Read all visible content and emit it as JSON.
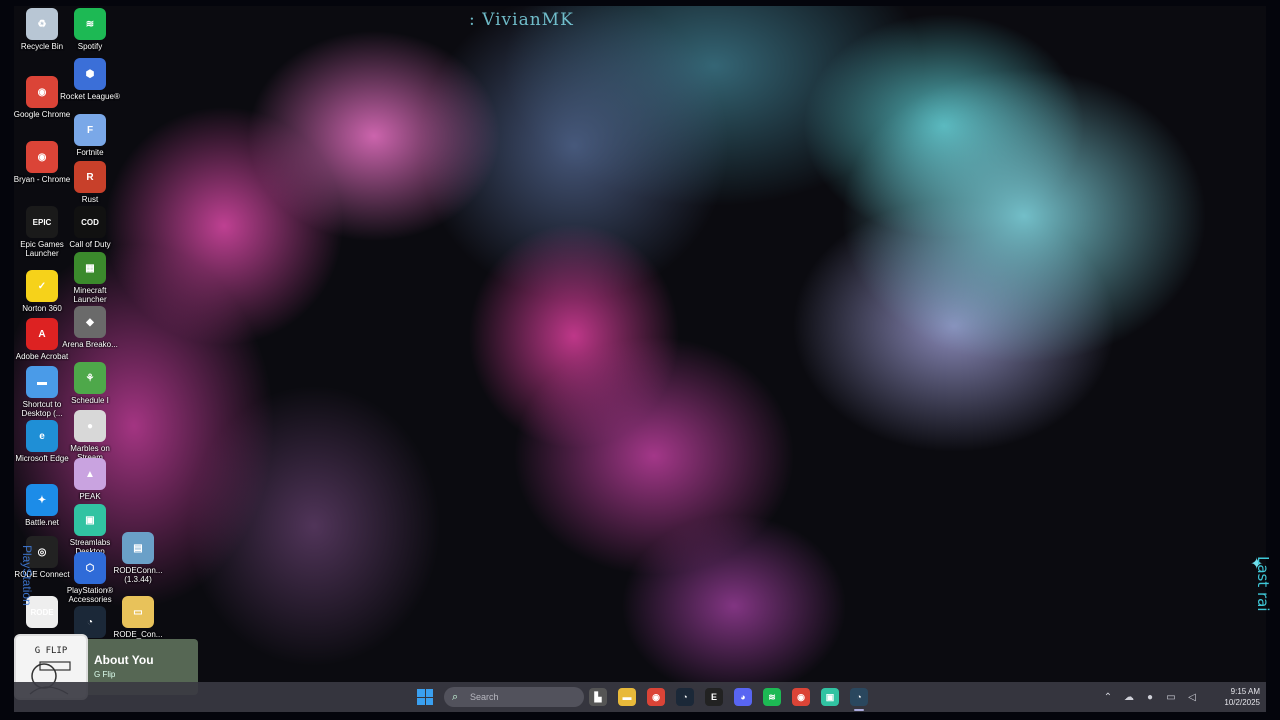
{
  "overlay": {
    "name": ": VivianMK",
    "side_text": "Last rai",
    "left_vertical": "PlayStation"
  },
  "desktop_icons": {
    "col1": [
      {
        "label": "Recycle Bin",
        "icon": "recycle-bin-icon",
        "color": "#b8c6d4",
        "glyph": "♻"
      },
      {
        "label": "Google Chrome",
        "icon": "chrome-icon",
        "color": "#db4437",
        "glyph": "◉"
      },
      {
        "label": "Bryan - Chrome",
        "icon": "chrome-profile-icon",
        "color": "#db4437",
        "glyph": "◉"
      },
      {
        "label": "Epic Games Launcher",
        "icon": "epic-games-icon",
        "color": "#1a1a1a",
        "glyph": "EPIC"
      },
      {
        "label": "Norton 360",
        "icon": "norton-icon",
        "color": "#f6d21a",
        "glyph": "✓"
      },
      {
        "label": "Adobe Acrobat",
        "icon": "acrobat-icon",
        "color": "#d22",
        "glyph": "A"
      },
      {
        "label": "Shortcut to Desktop (...",
        "icon": "shortcut-icon",
        "color": "#4a9be8",
        "glyph": "▬"
      },
      {
        "label": "Microsoft Edge",
        "icon": "edge-icon",
        "color": "#1f8fd6",
        "glyph": "e"
      },
      {
        "label": "Battle.net",
        "icon": "battlenet-icon",
        "color": "#1c8ce8",
        "glyph": "✦"
      },
      {
        "label": "RODE Connect",
        "icon": "rode-connect-icon",
        "color": "#222",
        "glyph": "◎"
      },
      {
        "label": "",
        "icon": "rode-icon",
        "color": "#eee",
        "glyph": "RODE"
      }
    ],
    "col2": [
      {
        "label": "Spotify",
        "icon": "spotify-icon",
        "color": "#1db954",
        "glyph": "≋"
      },
      {
        "label": "Rocket League®",
        "icon": "rocket-league-icon",
        "color": "#3b6fd8",
        "glyph": "⬢"
      },
      {
        "label": "Fortnite",
        "icon": "fortnite-icon",
        "color": "#7aa8e8",
        "glyph": "F"
      },
      {
        "label": "Rust",
        "icon": "rust-icon",
        "color": "#c8402a",
        "glyph": "R"
      },
      {
        "label": "Call of Duty",
        "icon": "call-of-duty-icon",
        "color": "#111",
        "glyph": "COD"
      },
      {
        "label": "Minecraft Launcher",
        "icon": "minecraft-icon",
        "color": "#3b8a2c",
        "glyph": "▦"
      },
      {
        "label": "Arena Breako...",
        "icon": "arena-breakout-icon",
        "color": "#6a6a6a",
        "glyph": "◆"
      },
      {
        "label": "Schedule I",
        "icon": "schedule-one-icon",
        "color": "#4ea84a",
        "glyph": "⚘"
      },
      {
        "label": "Marbles on Stream",
        "icon": "marbles-icon",
        "color": "#d8d8d8",
        "glyph": "●"
      },
      {
        "label": "PEAK",
        "icon": "peak-icon",
        "color": "#c9a3e0",
        "glyph": "▲"
      },
      {
        "label": "Streamlabs Desktop",
        "icon": "streamlabs-icon",
        "color": "#31c3a2",
        "glyph": "▣"
      },
      {
        "label": "PlayStation® Accessories",
        "icon": "playstation-icon",
        "color": "#2f6bd8",
        "glyph": "⬡"
      },
      {
        "label": "",
        "icon": "steam-icon",
        "color": "#1b2838",
        "glyph": "◔"
      }
    ],
    "col3": [
      {
        "label": "RODEConn... (1.3.44)",
        "icon": "installer-icon",
        "color": "#6aa0c8",
        "glyph": "▤"
      },
      {
        "label": "RODE_Con...",
        "icon": "folder-icon",
        "color": "#e8c25a",
        "glyph": "▭"
      }
    ]
  },
  "now_playing": {
    "title": "About You",
    "artist": "G Flip",
    "art_text": "G FLIP"
  },
  "taskbar": {
    "search_placeholder": "Search",
    "apps": [
      {
        "name": "task-view",
        "icon": "task-view-icon",
        "color": "#555",
        "glyph": "▙"
      },
      {
        "name": "file-explorer",
        "icon": "file-explorer-icon",
        "color": "#e8b93a",
        "glyph": "▬"
      },
      {
        "name": "chrome",
        "icon": "chrome-icon",
        "color": "#db4437",
        "glyph": "◉"
      },
      {
        "name": "steam",
        "icon": "steam-icon",
        "color": "#1b2838",
        "glyph": "◔"
      },
      {
        "name": "epic-games",
        "icon": "epic-games-icon",
        "color": "#222",
        "glyph": "E"
      },
      {
        "name": "discord",
        "icon": "discord-icon",
        "color": "#5865f2",
        "glyph": "◕"
      },
      {
        "name": "spotify",
        "icon": "spotify-icon",
        "color": "#1db954",
        "glyph": "≋"
      },
      {
        "name": "chrome-profile",
        "icon": "chrome-profile-icon",
        "color": "#db4437",
        "glyph": "◉"
      },
      {
        "name": "streamlabs",
        "icon": "streamlabs-icon",
        "color": "#31c3a2",
        "glyph": "▣"
      },
      {
        "name": "steam-active",
        "icon": "steam-icon",
        "color": "#2a475e",
        "glyph": "◔"
      }
    ],
    "tray": [
      {
        "name": "show-hidden-icons",
        "glyph": "⌃"
      },
      {
        "name": "onedrive-icon",
        "glyph": "☁"
      },
      {
        "name": "microphone-icon",
        "glyph": "●"
      },
      {
        "name": "network-icon",
        "glyph": "▭"
      },
      {
        "name": "volume-icon",
        "glyph": "◁"
      }
    ],
    "time": "9:15 AM",
    "date": "10/2/2025"
  }
}
